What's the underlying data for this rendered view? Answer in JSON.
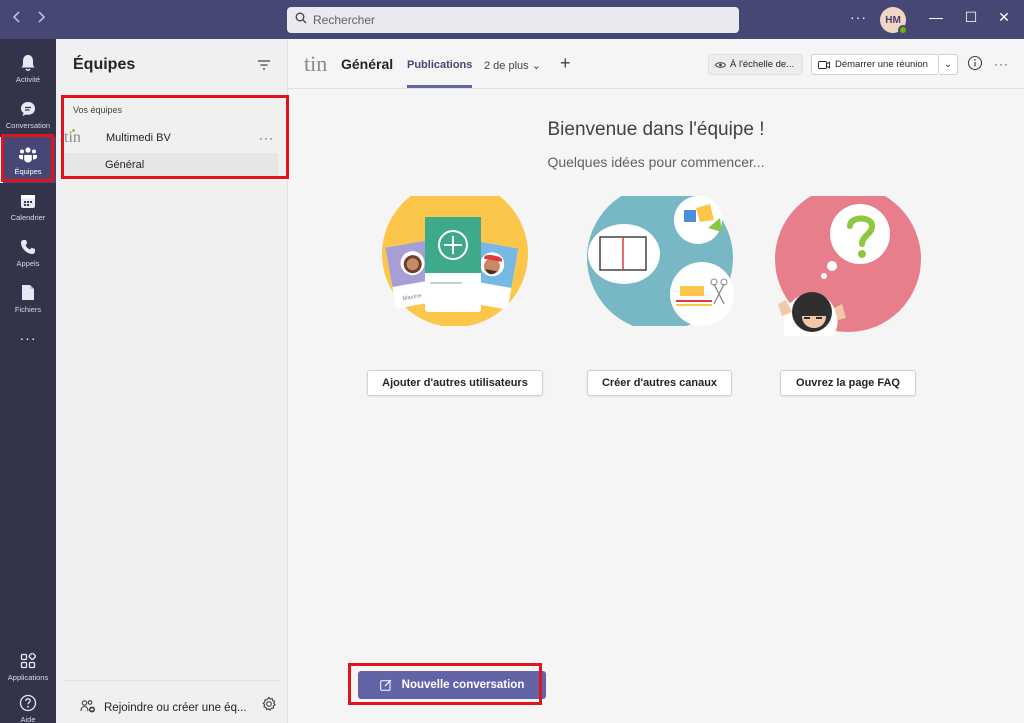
{
  "titlebar": {
    "back_icon": "chevron-left-icon",
    "forward_icon": "chevron-right-icon",
    "search_placeholder": "Rechercher",
    "more_label": "···",
    "avatar_initials": "HM",
    "presence_color": "#6bb700",
    "minimize_label": "—",
    "maximize_label": "☐",
    "close_label": "✕"
  },
  "rail": {
    "items": [
      {
        "label": "Activité",
        "icon": "bell-icon"
      },
      {
        "label": "Conversation",
        "icon": "chat-icon"
      },
      {
        "label": "Équipes",
        "icon": "teams-icon"
      },
      {
        "label": "Calendrier",
        "icon": "calendar-icon"
      },
      {
        "label": "Appels",
        "icon": "phone-icon"
      },
      {
        "label": "Fichiers",
        "icon": "file-icon"
      }
    ],
    "more_label": "···",
    "bottom_items": [
      {
        "label": "Applications",
        "icon": "apps-icon"
      },
      {
        "label": "Aide",
        "icon": "help-icon"
      }
    ]
  },
  "teams_panel": {
    "title": "Équipes",
    "section_label": "Vos équipes",
    "team": {
      "logo": "tin",
      "name": "Multimedi BV",
      "more": "···"
    },
    "channel": "Général",
    "join_label": "Rejoindre ou créer une éq..."
  },
  "header": {
    "logo": "tin",
    "channel_title": "Général",
    "tabs": [
      {
        "label": "Publications",
        "active": true
      },
      {
        "label": "2 de plus ⌄",
        "active": false
      }
    ],
    "add_tab": "+",
    "org_wide_label": "À l'échelle de...",
    "meet_label": "Démarrer une réunion",
    "meet_caret": "⌄",
    "info_icon": "info-icon",
    "more_label": "···"
  },
  "main": {
    "welcome_title": "Bienvenue dans l'équipe !",
    "welcome_sub": "Quelques idées pour commencer...",
    "illustrations": [
      {
        "name": "people-cards-illustration",
        "color": "#fcc64a",
        "caption": "Maxine"
      },
      {
        "name": "channels-illustration",
        "color": "#78b8c4"
      },
      {
        "name": "faq-illustration",
        "color": "#e87e8c"
      }
    ],
    "actions": [
      "Ajouter d'autres utilisateurs",
      "Créer d'autres canaux",
      "Ouvrez la page FAQ"
    ],
    "new_conversation_label": "Nouvelle conversation"
  },
  "colors": {
    "titlebar": "#464775",
    "rail": "#33344a",
    "accent": "#6264a7",
    "highlight_box": "#e0141e"
  }
}
